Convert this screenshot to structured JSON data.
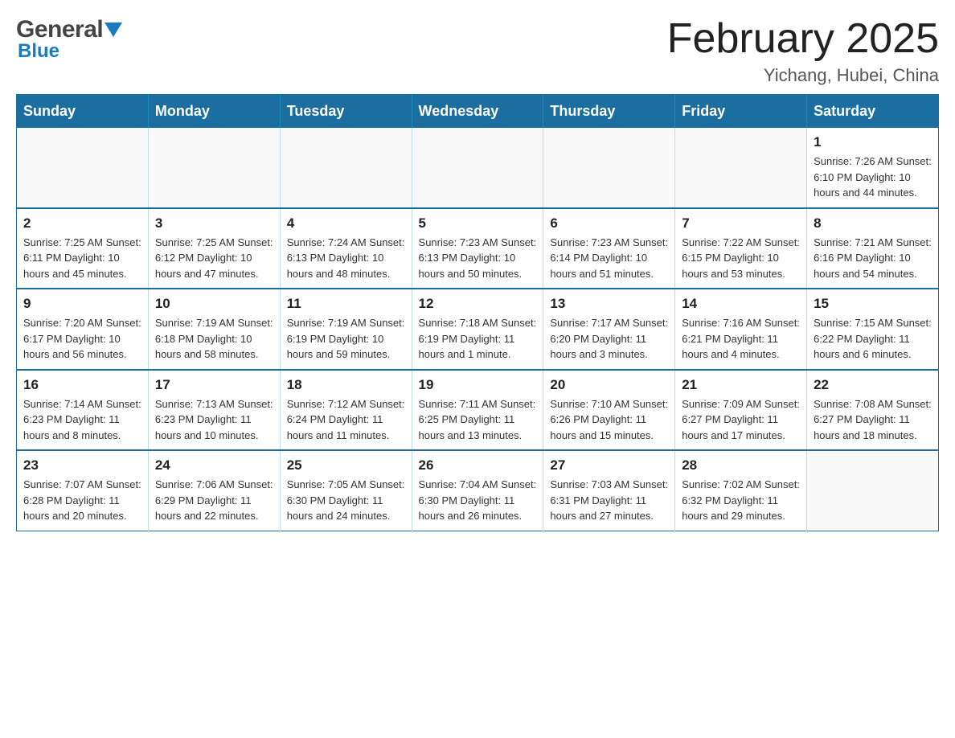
{
  "header": {
    "logo_general": "General",
    "logo_blue": "Blue",
    "month_title": "February 2025",
    "location": "Yichang, Hubei, China"
  },
  "days_of_week": [
    "Sunday",
    "Monday",
    "Tuesday",
    "Wednesday",
    "Thursday",
    "Friday",
    "Saturday"
  ],
  "weeks": [
    [
      {
        "num": "",
        "info": ""
      },
      {
        "num": "",
        "info": ""
      },
      {
        "num": "",
        "info": ""
      },
      {
        "num": "",
        "info": ""
      },
      {
        "num": "",
        "info": ""
      },
      {
        "num": "",
        "info": ""
      },
      {
        "num": "1",
        "info": "Sunrise: 7:26 AM\nSunset: 6:10 PM\nDaylight: 10 hours and 44 minutes."
      }
    ],
    [
      {
        "num": "2",
        "info": "Sunrise: 7:25 AM\nSunset: 6:11 PM\nDaylight: 10 hours and 45 minutes."
      },
      {
        "num": "3",
        "info": "Sunrise: 7:25 AM\nSunset: 6:12 PM\nDaylight: 10 hours and 47 minutes."
      },
      {
        "num": "4",
        "info": "Sunrise: 7:24 AM\nSunset: 6:13 PM\nDaylight: 10 hours and 48 minutes."
      },
      {
        "num": "5",
        "info": "Sunrise: 7:23 AM\nSunset: 6:13 PM\nDaylight: 10 hours and 50 minutes."
      },
      {
        "num": "6",
        "info": "Sunrise: 7:23 AM\nSunset: 6:14 PM\nDaylight: 10 hours and 51 minutes."
      },
      {
        "num": "7",
        "info": "Sunrise: 7:22 AM\nSunset: 6:15 PM\nDaylight: 10 hours and 53 minutes."
      },
      {
        "num": "8",
        "info": "Sunrise: 7:21 AM\nSunset: 6:16 PM\nDaylight: 10 hours and 54 minutes."
      }
    ],
    [
      {
        "num": "9",
        "info": "Sunrise: 7:20 AM\nSunset: 6:17 PM\nDaylight: 10 hours and 56 minutes."
      },
      {
        "num": "10",
        "info": "Sunrise: 7:19 AM\nSunset: 6:18 PM\nDaylight: 10 hours and 58 minutes."
      },
      {
        "num": "11",
        "info": "Sunrise: 7:19 AM\nSunset: 6:19 PM\nDaylight: 10 hours and 59 minutes."
      },
      {
        "num": "12",
        "info": "Sunrise: 7:18 AM\nSunset: 6:19 PM\nDaylight: 11 hours and 1 minute."
      },
      {
        "num": "13",
        "info": "Sunrise: 7:17 AM\nSunset: 6:20 PM\nDaylight: 11 hours and 3 minutes."
      },
      {
        "num": "14",
        "info": "Sunrise: 7:16 AM\nSunset: 6:21 PM\nDaylight: 11 hours and 4 minutes."
      },
      {
        "num": "15",
        "info": "Sunrise: 7:15 AM\nSunset: 6:22 PM\nDaylight: 11 hours and 6 minutes."
      }
    ],
    [
      {
        "num": "16",
        "info": "Sunrise: 7:14 AM\nSunset: 6:23 PM\nDaylight: 11 hours and 8 minutes."
      },
      {
        "num": "17",
        "info": "Sunrise: 7:13 AM\nSunset: 6:23 PM\nDaylight: 11 hours and 10 minutes."
      },
      {
        "num": "18",
        "info": "Sunrise: 7:12 AM\nSunset: 6:24 PM\nDaylight: 11 hours and 11 minutes."
      },
      {
        "num": "19",
        "info": "Sunrise: 7:11 AM\nSunset: 6:25 PM\nDaylight: 11 hours and 13 minutes."
      },
      {
        "num": "20",
        "info": "Sunrise: 7:10 AM\nSunset: 6:26 PM\nDaylight: 11 hours and 15 minutes."
      },
      {
        "num": "21",
        "info": "Sunrise: 7:09 AM\nSunset: 6:27 PM\nDaylight: 11 hours and 17 minutes."
      },
      {
        "num": "22",
        "info": "Sunrise: 7:08 AM\nSunset: 6:27 PM\nDaylight: 11 hours and 18 minutes."
      }
    ],
    [
      {
        "num": "23",
        "info": "Sunrise: 7:07 AM\nSunset: 6:28 PM\nDaylight: 11 hours and 20 minutes."
      },
      {
        "num": "24",
        "info": "Sunrise: 7:06 AM\nSunset: 6:29 PM\nDaylight: 11 hours and 22 minutes."
      },
      {
        "num": "25",
        "info": "Sunrise: 7:05 AM\nSunset: 6:30 PM\nDaylight: 11 hours and 24 minutes."
      },
      {
        "num": "26",
        "info": "Sunrise: 7:04 AM\nSunset: 6:30 PM\nDaylight: 11 hours and 26 minutes."
      },
      {
        "num": "27",
        "info": "Sunrise: 7:03 AM\nSunset: 6:31 PM\nDaylight: 11 hours and 27 minutes."
      },
      {
        "num": "28",
        "info": "Sunrise: 7:02 AM\nSunset: 6:32 PM\nDaylight: 11 hours and 29 minutes."
      },
      {
        "num": "",
        "info": ""
      }
    ]
  ]
}
